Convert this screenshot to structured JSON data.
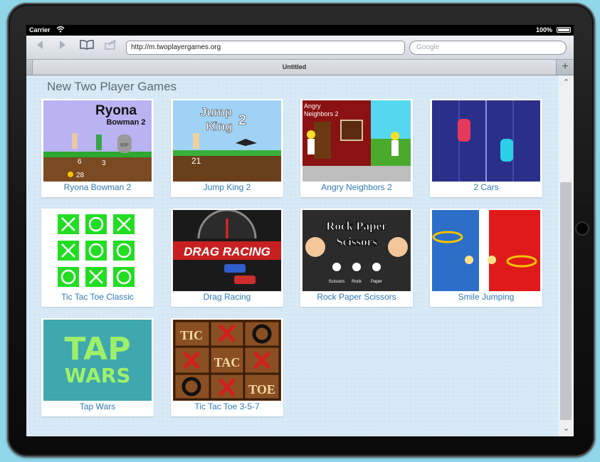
{
  "status_bar": {
    "carrier": "Carrier",
    "battery": "100%"
  },
  "toolbar": {
    "url": "http://m.twoplayergames.org",
    "search_placeholder": "Google"
  },
  "tab": {
    "title": "Untitled",
    "new_tab": "+"
  },
  "page": {
    "heading": "New Two Player Games"
  },
  "games": [
    {
      "label": "Ryona Bowman 2"
    },
    {
      "label": "Jump King 2"
    },
    {
      "label": "Angry Neighbors 2"
    },
    {
      "label": "2 Cars"
    },
    {
      "label": "Tic Tac Toe Classic"
    },
    {
      "label": "Drag Racing"
    },
    {
      "label": "Rock Paper Scissors"
    },
    {
      "label": "Smile Jumping"
    },
    {
      "label": "Tap Wars"
    },
    {
      "label": "Tic Tac Toe 3-5-7"
    }
  ],
  "thumb_text": {
    "ryona_title": "Ryona",
    "ryona_sub": "Bowman 2",
    "ryona_rip": "RIP",
    "ryona_n1": "6",
    "ryona_n2": "3",
    "ryona_coins": "28",
    "jump_l1": "Jump",
    "jump_l2": "King",
    "jump_l3": "2",
    "jump_score": "21",
    "angry_l1": "Angry",
    "angry_l2": "Neighbors 2",
    "drag_text": "DRAG RACING",
    "rps_l1": "Rock Paper",
    "rps_l2": "Scissors",
    "rps_b1": "Scissors",
    "rps_b2": "Rock",
    "rps_b3": "Paper",
    "tap_l1": "TAP",
    "tap_l2": "WARS",
    "ttt_tic": "TIC",
    "ttt_tac": "TAC",
    "ttt_toe": "TOE"
  },
  "colors": {
    "link": "#2f79b5",
    "content_bg": "#d6e8f5",
    "ttt_green": "#22dd22",
    "tap_bg": "#3fa7ae",
    "tap_text": "#9ef06a"
  }
}
